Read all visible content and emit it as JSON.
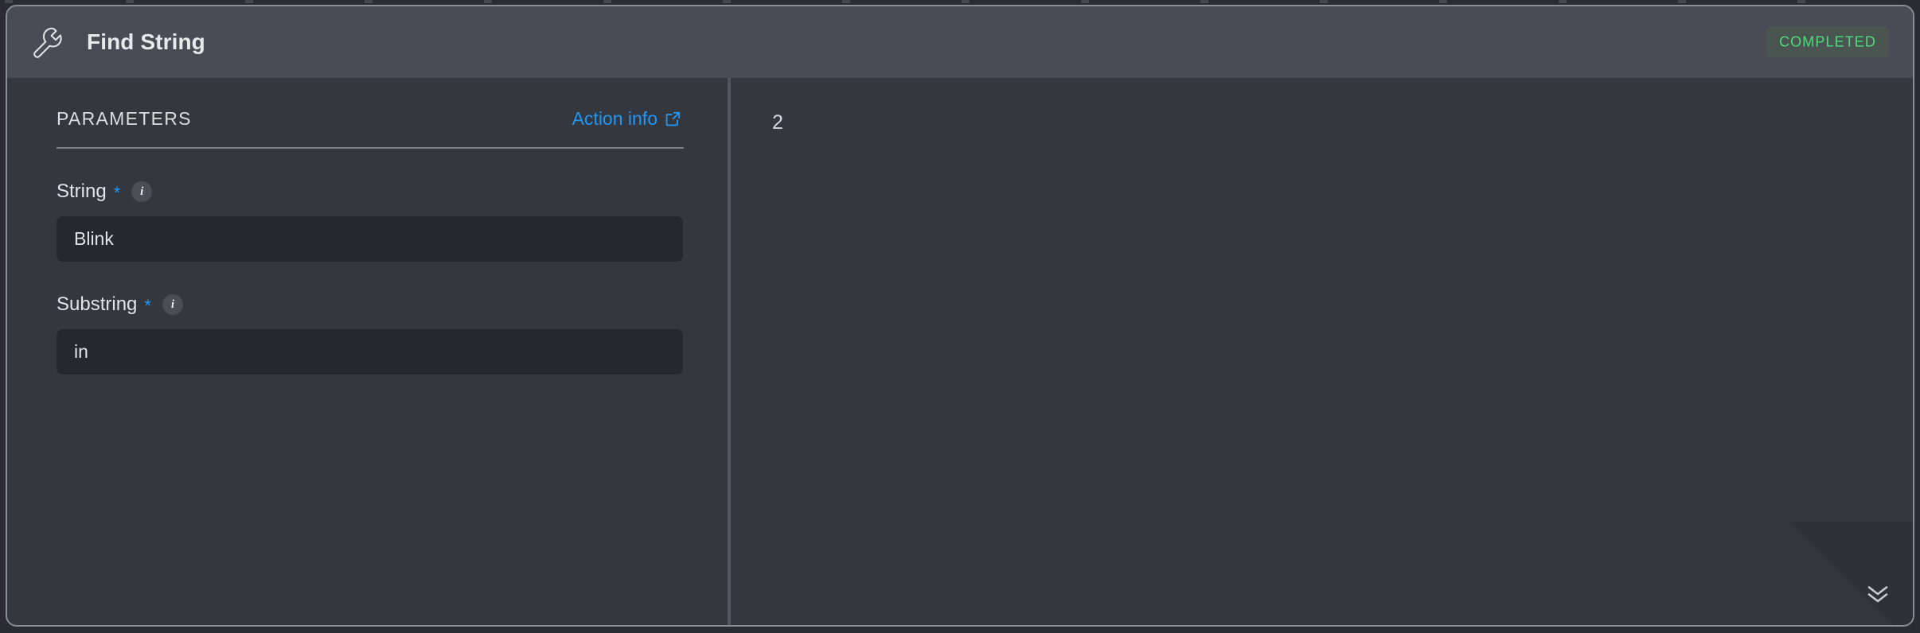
{
  "window": {
    "background_color": "#34373d",
    "border_color": "#8b8e94"
  },
  "header": {
    "icon": "wrench-icon",
    "title": "Find String",
    "background_color": "#4a4c55",
    "status": {
      "label": "COMPLETED",
      "text_color": "#4ddb7c",
      "background_color": "#4a5551"
    }
  },
  "parameters": {
    "section_title": "PARAMETERS",
    "action_info": {
      "label": "Action info",
      "icon": "external-link-icon",
      "color": "#2196f3"
    },
    "fields": [
      {
        "label": "String",
        "required_marker": "*",
        "info_icon": "info-icon",
        "info_glyph": "i",
        "value": "Blink",
        "placeholder": ""
      },
      {
        "label": "Substring",
        "required_marker": "*",
        "info_icon": "info-icon",
        "info_glyph": "i",
        "value": "in",
        "placeholder": ""
      }
    ]
  },
  "output": {
    "value": "2"
  },
  "footer": {
    "expand_icon": "chevron-double-down-icon"
  }
}
